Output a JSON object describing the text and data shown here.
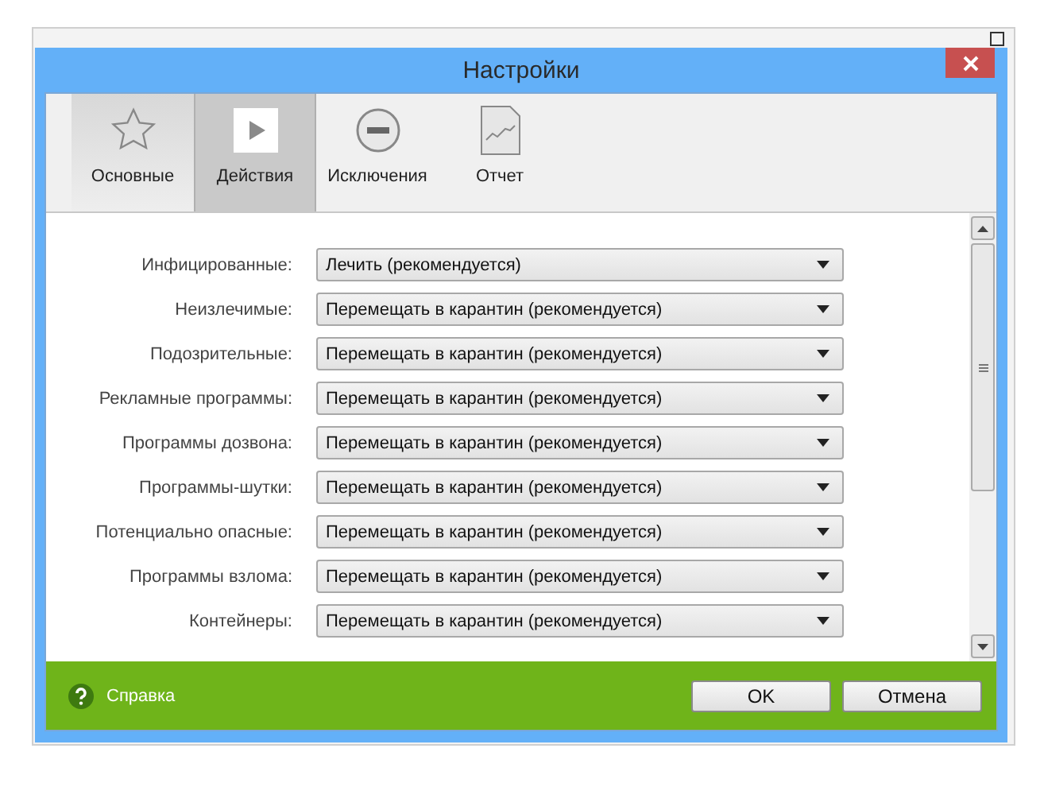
{
  "dialog": {
    "title": "Настройки"
  },
  "tabs": [
    {
      "label": "Основные",
      "selected": false,
      "hovered": true
    },
    {
      "label": "Действия",
      "selected": true,
      "hovered": false
    },
    {
      "label": "Исключения",
      "selected": false,
      "hovered": false
    },
    {
      "label": "Отчет",
      "selected": false,
      "hovered": false
    }
  ],
  "actions": [
    {
      "label": "Инфицированные:",
      "value": "Лечить (рекомендуется)"
    },
    {
      "label": "Неизлечимые:",
      "value": "Перемещать в карантин (рекомендуется)"
    },
    {
      "label": "Подозрительные:",
      "value": "Перемещать в карантин (рекомендуется)"
    },
    {
      "label": "Рекламные программы:",
      "value": "Перемещать в карантин (рекомендуется)"
    },
    {
      "label": "Программы дозвона:",
      "value": "Перемещать в карантин (рекомендуется)"
    },
    {
      "label": "Программы-шутки:",
      "value": "Перемещать в карантин (рекомендуется)"
    },
    {
      "label": "Потенциально опасные:",
      "value": "Перемещать в карантин (рекомендуется)"
    },
    {
      "label": "Программы взлома:",
      "value": "Перемещать в карантин (рекомендуется)"
    },
    {
      "label": "Контейнеры:",
      "value": "Перемещать в карантин (рекомендуется)"
    }
  ],
  "footer": {
    "help": "Справка",
    "buttons": [
      "OK",
      "Отмена"
    ]
  }
}
